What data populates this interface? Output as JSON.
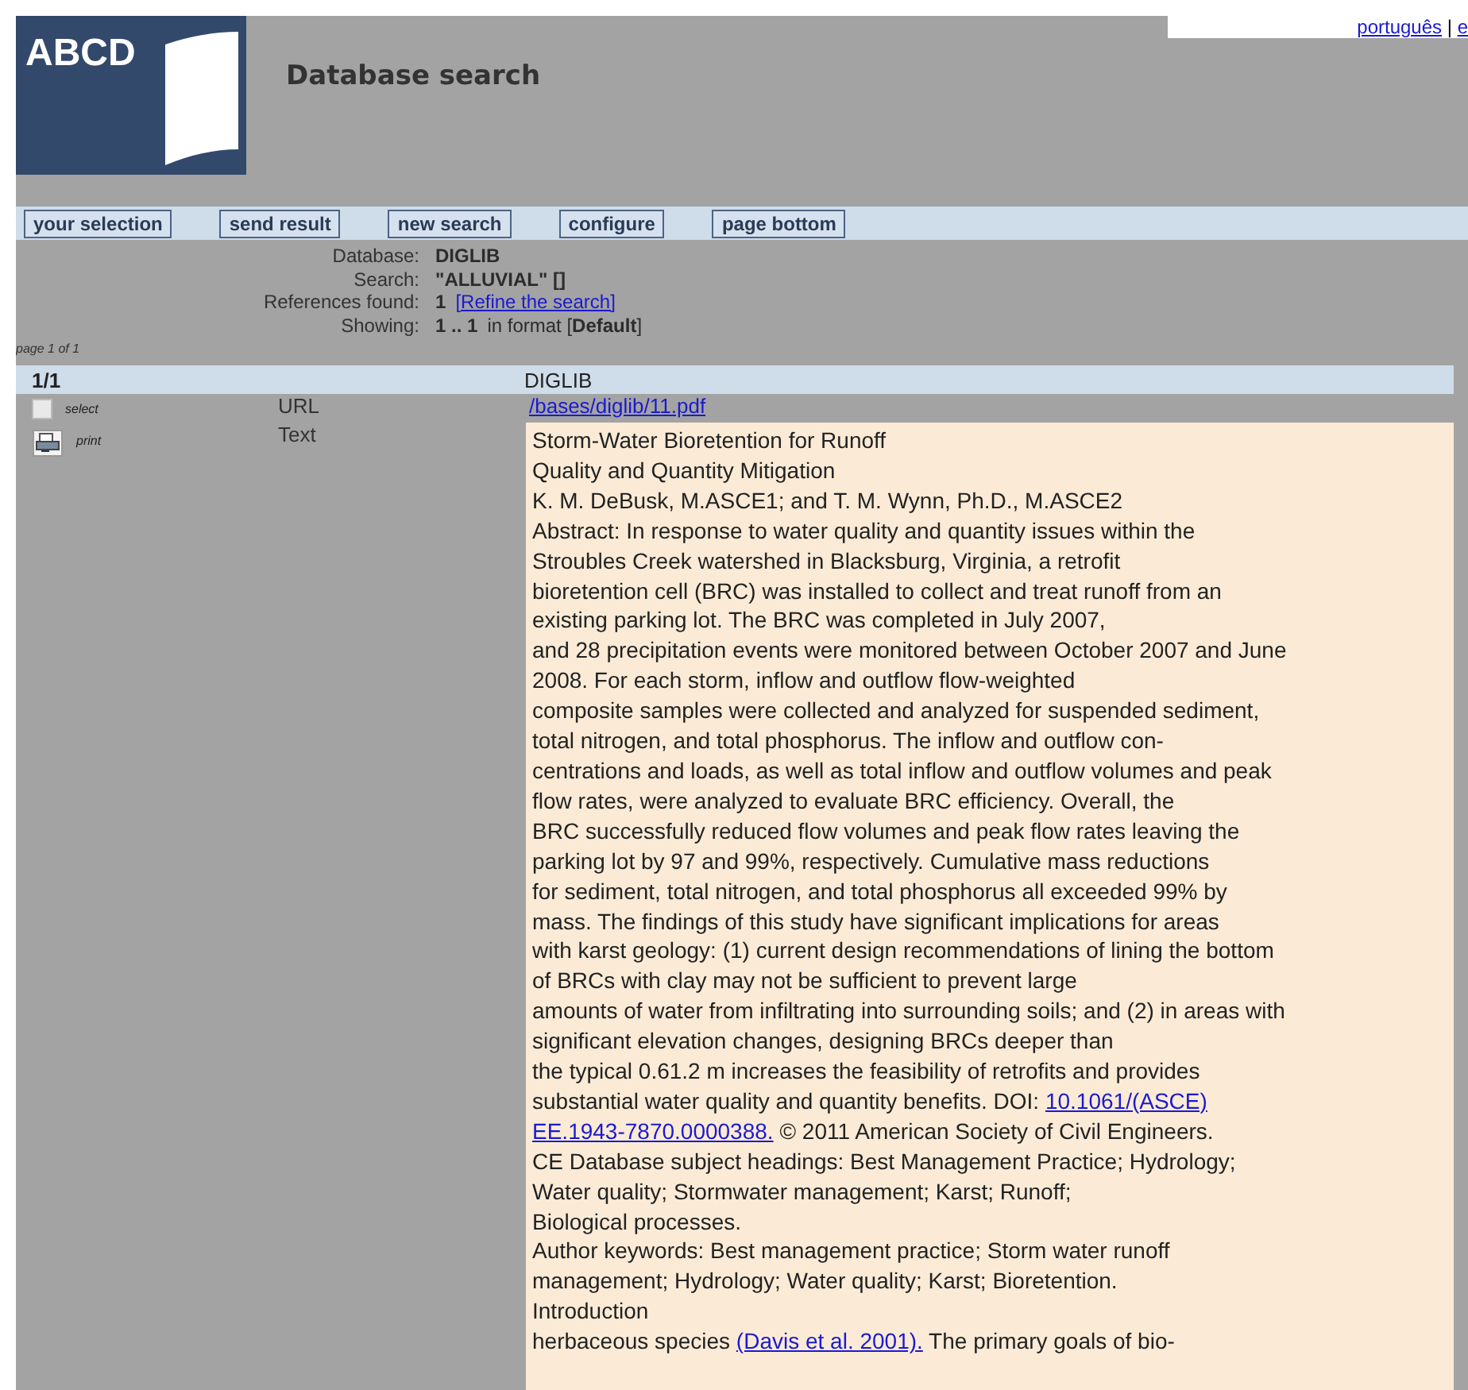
{
  "header": {
    "logo": "ABCD",
    "title": "Database search",
    "languages": [
      {
        "label": "português"
      },
      {
        "label": "e"
      }
    ],
    "language_separator": "|"
  },
  "toolbar": [
    "your selection",
    "send result",
    "new search",
    "configure",
    "page bottom"
  ],
  "info": [
    {
      "label": "Database:",
      "parts": [
        {
          "kind": "bold",
          "text": "DIGLIB"
        }
      ]
    },
    {
      "label": "Search:",
      "parts": [
        {
          "kind": "bold",
          "text": "\"ALLUVIAL\" []"
        }
      ]
    },
    {
      "label": "References found:",
      "parts": [
        {
          "kind": "bold",
          "text": "1"
        },
        {
          "kind": "link",
          "text": "[Refine the search]"
        }
      ]
    },
    {
      "label": "Showing:",
      "parts": [
        {
          "kind": "bold",
          "text": "1 .. 1"
        },
        {
          "kind": "plain",
          "text": "in format [**Default**]"
        }
      ]
    }
  ],
  "page_info": "page 1 of 1",
  "result_header": {
    "position": "1/1",
    "database": "DIGLIB"
  },
  "record": {
    "select": {
      "label": "select",
      "checked": false
    },
    "print": {
      "label": "print"
    },
    "url": {
      "label": "URL",
      "value": "/bases/diglib/11.pdf"
    },
    "text": {
      "label": "Text",
      "lines": [
        [
          {
            "kind": "plain",
            "text": "Storm-Water Bioretention for Runoff"
          }
        ],
        [
          {
            "kind": "plain",
            "text": "Quality and Quantity Mitigation"
          }
        ],
        [
          {
            "kind": "plain",
            "text": "K. M. DeBusk, M.ASCE1; and T. M. Wynn, Ph.D., M.ASCE2"
          }
        ],
        [
          {
            "kind": "plain",
            "text": "Abstract: In response to water quality and quantity issues within the"
          }
        ],
        [
          {
            "kind": "plain",
            "text": "Stroubles Creek watershed in Blacksburg, Virginia, a retrofit"
          }
        ],
        [
          {
            "kind": "plain",
            "text": "bioretention cell (BRC) was installed to collect and treat runoff from an"
          }
        ],
        [
          {
            "kind": "plain",
            "text": "existing parking lot. The BRC was completed in July 2007,"
          }
        ],
        [
          {
            "kind": "plain",
            "text": "and 28 precipitation events were monitored between October 2007 and June"
          }
        ],
        [
          {
            "kind": "plain",
            "text": "2008. For each storm, inflow and outflow flow-weighted"
          }
        ],
        [
          {
            "kind": "plain",
            "text": "composite samples were collected and analyzed for suspended sediment,"
          }
        ],
        [
          {
            "kind": "plain",
            "text": "total nitrogen, and total phosphorus. The inflow and outflow con-"
          }
        ],
        [
          {
            "kind": "plain",
            "text": "centrations and loads, as well as total inflow and outflow volumes and peak"
          }
        ],
        [
          {
            "kind": "plain",
            "text": "flow rates, were analyzed to evaluate BRC efficiency. Overall, the"
          }
        ],
        [
          {
            "kind": "plain",
            "text": "BRC successfully reduced flow volumes and peak flow rates leaving the"
          }
        ],
        [
          {
            "kind": "plain",
            "text": "parking lot by 97 and 99%, respectively. Cumulative mass reductions"
          }
        ],
        [
          {
            "kind": "plain",
            "text": "for sediment, total nitrogen, and total phosphorus all exceeded 99% by"
          }
        ],
        [
          {
            "kind": "plain",
            "text": "mass. The findings of this study have significant implications for areas"
          }
        ],
        [
          {
            "kind": "plain",
            "text": "with karst geology: (1) current design recommendations of lining the bottom"
          }
        ],
        [
          {
            "kind": "plain",
            "text": "of BRCs with clay may not be sufficient to prevent large"
          }
        ],
        [
          {
            "kind": "plain",
            "text": "amounts of water from infiltrating into surrounding soils; and (2) in areas with"
          }
        ],
        [
          {
            "kind": "plain",
            "text": "significant elevation changes, designing BRCs deeper than"
          }
        ],
        [
          {
            "kind": "plain",
            "text": "the typical 0.61.2 m increases the feasibility of retrofits and provides"
          }
        ],
        [
          {
            "kind": "plain",
            "text": "substantial water quality and quantity benefits. DOI: "
          },
          {
            "kind": "link",
            "text": "10.1061/(ASCE)"
          }
        ],
        [
          {
            "kind": "link",
            "text": "EE.1943-7870.0000388."
          },
          {
            "kind": "plain",
            "text": " © 2011 American Society of Civil Engineers."
          }
        ],
        [
          {
            "kind": "plain",
            "text": "CE Database subject headings: Best Management Practice; Hydrology;"
          }
        ],
        [
          {
            "kind": "plain",
            "text": "Water quality; Stormwater management; Karst; Runoff;"
          }
        ],
        [
          {
            "kind": "plain",
            "text": "Biological processes."
          }
        ],
        [
          {
            "kind": "plain",
            "text": "Author keywords: Best management practice; Storm water runoff"
          }
        ],
        [
          {
            "kind": "plain",
            "text": "management; Hydrology; Water quality; Karst; Bioretention."
          }
        ],
        [
          {
            "kind": "plain",
            "text": "Introduction"
          }
        ],
        [
          {
            "kind": "plain",
            "text": "herbaceous species "
          },
          {
            "kind": "link",
            "text": "(Davis et al. 2001)."
          },
          {
            "kind": "plain",
            "text": " The primary goals of bio-"
          }
        ]
      ]
    }
  }
}
